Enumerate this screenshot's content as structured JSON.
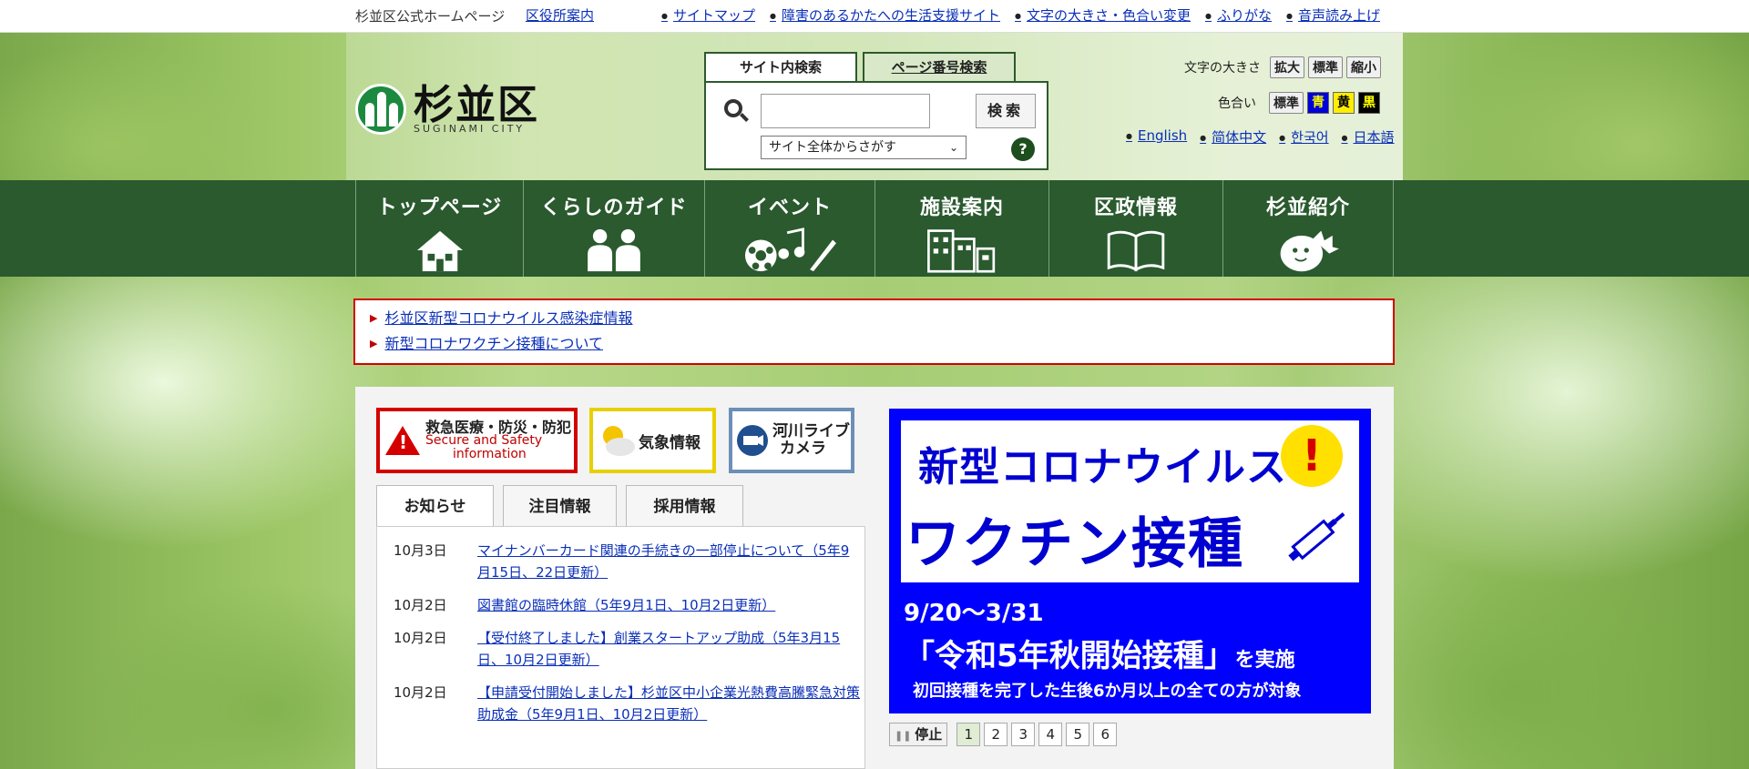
{
  "topbar": {
    "site_name": "杉並区公式ホームページ",
    "office_link": "区役所案内",
    "links": [
      "サイトマップ",
      "障害のあるかたへの生活支援サイト",
      "文字の大きさ・色合い変更",
      "ふりがな",
      "音声読み上げ"
    ]
  },
  "logo": {
    "jp": "杉並区",
    "en": "SUGINAMI CITY"
  },
  "search": {
    "tabs": [
      "サイト内検索",
      "ページ番号検索"
    ],
    "input_value": "",
    "button": "検索",
    "scope": "サイト全体からさがす",
    "help": "?"
  },
  "textsize": {
    "label": "文字の大きさ",
    "buttons": [
      "拡大",
      "標準",
      "縮小"
    ]
  },
  "colors": {
    "label": "色合い",
    "standard": "標準",
    "blue": "青",
    "yellow": "黄",
    "black": "黒"
  },
  "languages": [
    "English",
    "简体中文",
    "한국어",
    "日本語"
  ],
  "gnav": [
    "トップページ",
    "くらしのガイド",
    "イベント",
    "施設案内",
    "区政情報",
    "杉並紹介"
  ],
  "alert": [
    "杉並区新型コロナウイルス感染症情報",
    "新型コロナワクチン接種について"
  ],
  "quick": {
    "emergency_jp": "救急医療・防災・防犯",
    "emergency_en1": "Secure and Safety",
    "emergency_en2": "information",
    "weather": "気象情報",
    "river1": "河川ライブ",
    "river2": "カメラ"
  },
  "tabs": [
    "お知らせ",
    "注目情報",
    "採用情報"
  ],
  "news": [
    {
      "date": "10月3日",
      "text": "マイナンバーカード関連の手続きの一部停止について（5年9月15日、22日更新）"
    },
    {
      "date": "10月2日",
      "text": "図書館の臨時休館（5年9月1日、10月2日更新）"
    },
    {
      "date": "10月2日",
      "text": "【受付終了しました】創業スタートアップ助成（5年3月15日、10月2日更新）"
    },
    {
      "date": "10月2日",
      "text": "【申請受付開始しました】杉並区中小企業光熱費高騰緊急対策助成金（5年9月1日、10月2日更新）"
    }
  ],
  "banner": {
    "line1": "新型コロナウイルス",
    "exclaim": "!",
    "line2": "ワクチン接種",
    "date": "9/20～3/31",
    "main": "「令和5年秋開始接種」",
    "main_suffix": "を実施",
    "sub": "初回接種を完了した生後6か月以上の全ての方が対象"
  },
  "pager": {
    "stop": "停止",
    "pages": [
      "1",
      "2",
      "3",
      "4",
      "5",
      "6"
    ]
  },
  "theme": {
    "nav_green": "#2a5a2e",
    "alert_red": "#d40000",
    "banner_blue": "#0000ff",
    "link": "#0a2fb8"
  }
}
